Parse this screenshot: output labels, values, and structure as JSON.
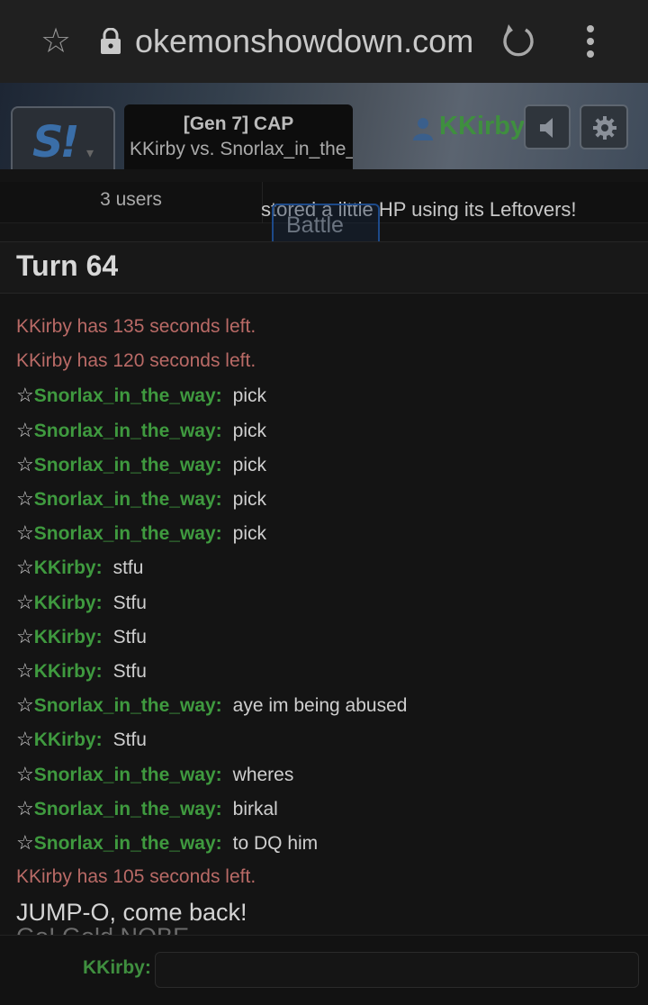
{
  "browser": {
    "url": "okemonshowdown.com"
  },
  "header": {
    "tab_title": "[Gen 7] CAP",
    "tab_subtitle": "KKirby vs. Snorlax_in_the_",
    "username": "KKirby",
    "logo": "S!"
  },
  "controls": {
    "users_count": "3 users",
    "battle_message": "stored a little HP using its Leftovers!",
    "battle_button": "Battle"
  },
  "turn": "Turn 64",
  "log": [
    {
      "type": "timer",
      "text": "KKirby has 135 seconds left."
    },
    {
      "type": "timer",
      "text": "KKirby has 120 seconds left."
    },
    {
      "type": "chat",
      "star": "☆",
      "user": "Snorlax_in_the_way:",
      "message": "pick"
    },
    {
      "type": "chat",
      "star": "☆",
      "user": "Snorlax_in_the_way:",
      "message": "pick"
    },
    {
      "type": "chat",
      "star": "☆",
      "user": "Snorlax_in_the_way:",
      "message": "pick"
    },
    {
      "type": "chat",
      "star": "☆",
      "user": "Snorlax_in_the_way:",
      "message": "pick"
    },
    {
      "type": "chat",
      "star": "☆",
      "user": "Snorlax_in_the_way:",
      "message": "pick"
    },
    {
      "type": "chat",
      "star": "☆",
      "user": "KKirby:",
      "message": "stfu"
    },
    {
      "type": "chat",
      "star": "☆",
      "user": "KKirby:",
      "message": "Stfu"
    },
    {
      "type": "chat",
      "star": "☆",
      "user": "KKirby:",
      "message": "Stfu"
    },
    {
      "type": "chat",
      "star": "☆",
      "user": "KKirby:",
      "message": "Stfu"
    },
    {
      "type": "chat",
      "star": "☆",
      "user": "Snorlax_in_the_way:",
      "message": "aye im being abused"
    },
    {
      "type": "chat",
      "star": "☆",
      "user": "KKirby:",
      "message": "Stfu"
    },
    {
      "type": "chat",
      "star": "☆",
      "user": "Snorlax_in_the_way:",
      "message": "wheres"
    },
    {
      "type": "chat",
      "star": "☆",
      "user": "Snorlax_in_the_way:",
      "message": "birkal"
    },
    {
      "type": "chat",
      "star": "☆",
      "user": "Snorlax_in_the_way:",
      "message": "to DQ him"
    },
    {
      "type": "timer",
      "text": "KKirby has 105 seconds left."
    }
  ],
  "jump_text": "JUMP-O, come back!",
  "cut_text": "Go! Gold NOBE ...",
  "chat": {
    "label": "KKirby:",
    "value": ""
  }
}
